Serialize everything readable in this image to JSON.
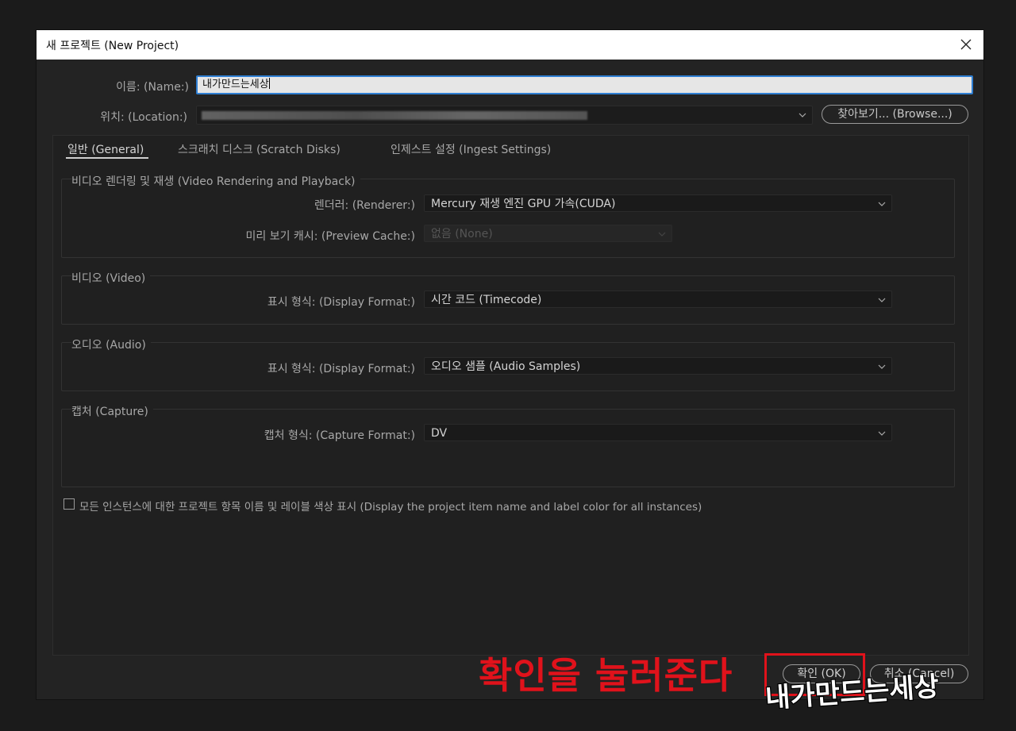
{
  "window": {
    "title": "새 프로젝트 (New Project)"
  },
  "form": {
    "name_label": "이름: (Name:)",
    "name_value": "내가만드는세상",
    "location_label": "위치: (Location:)",
    "browse_label": "찾아보기... (Browse...)"
  },
  "tabs": [
    {
      "label": "일반 (General)",
      "active": true
    },
    {
      "label": "스크래치 디스크 (Scratch Disks)",
      "active": false
    },
    {
      "label": "인제스트 설정 (Ingest Settings)",
      "active": false
    }
  ],
  "groups": {
    "rendering": {
      "title": "비디오 렌더링 및 재생 (Video Rendering and Playback)",
      "renderer_label": "렌더러: (Renderer:)",
      "renderer_value": "Mercury 재생 엔진 GPU 가속(CUDA)",
      "preview_cache_label": "미리 보기 캐시: (Preview Cache:)",
      "preview_cache_value": "없음 (None)"
    },
    "video": {
      "title": "비디오 (Video)",
      "display_format_label": "표시 형식: (Display Format:)",
      "display_format_value": "시간 코드 (Timecode)"
    },
    "audio": {
      "title": "오디오 (Audio)",
      "display_format_label": "표시 형식: (Display Format:)",
      "display_format_value": "오디오 샘플 (Audio Samples)"
    },
    "capture": {
      "title": "캡처 (Capture)",
      "capture_format_label": "캡처 형식: (Capture Format:)",
      "capture_format_value": "DV"
    }
  },
  "checkbox": {
    "label": "모든 인스턴스에 대한 프로젝트 항목 이름 및 레이블 색상 표시 (Display the project item name and label color for all instances)",
    "checked": false
  },
  "buttons": {
    "ok_label": "확인 (OK)",
    "cancel_label": "취소 (Cancel)"
  },
  "annotation": {
    "text": "확인을 눌러준다",
    "color": "#e0121b"
  },
  "watermark": {
    "text": "내가만드는세상"
  },
  "colors": {
    "focus_border": "#2f7fd3",
    "dialog_bg": "#232323"
  },
  "icons": {
    "close": "close-icon",
    "dropdown": "chevron-down-icon",
    "checkbox": "checkbox-icon"
  }
}
